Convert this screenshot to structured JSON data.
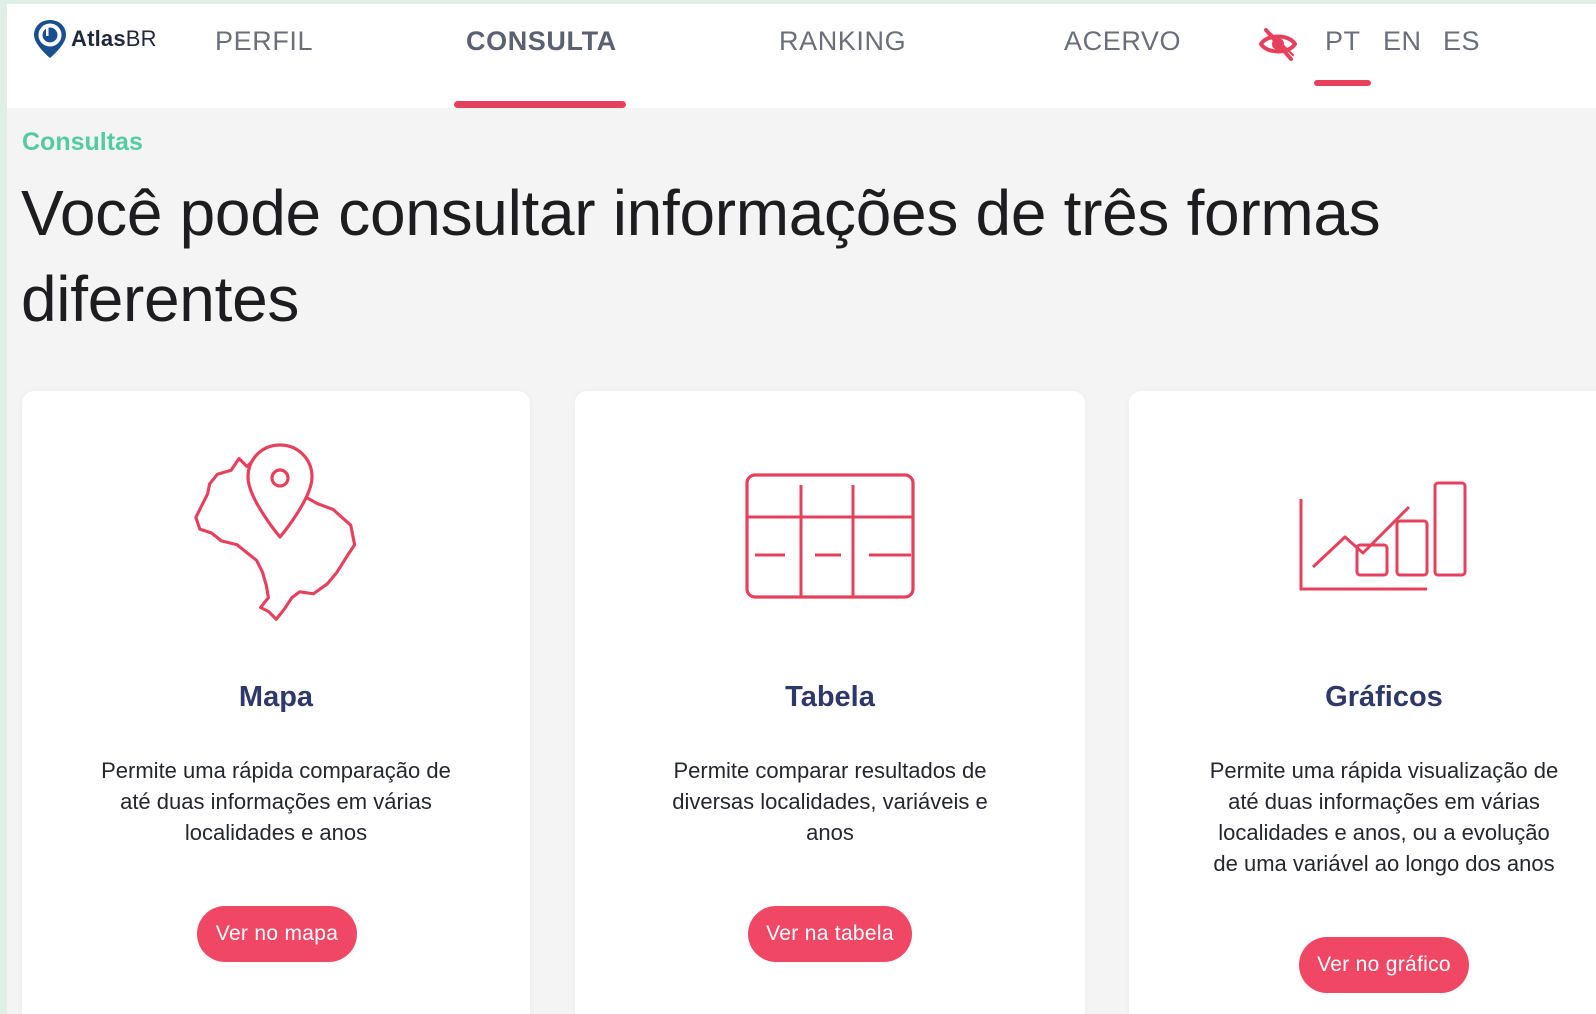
{
  "brand": {
    "name_bold": "Atlas",
    "name_light": "BR"
  },
  "nav": {
    "items": [
      {
        "label": "PERFIL"
      },
      {
        "label": "CONSULTA"
      },
      {
        "label": "RANKING"
      },
      {
        "label": "ACERVO"
      }
    ],
    "active": "CONSULTA",
    "languages": [
      "PT",
      "EN",
      "ES"
    ],
    "active_language": "PT",
    "accessibility_icon": "eye-off-icon"
  },
  "page": {
    "eyebrow": "Consultas",
    "headline": "Você pode consultar informações de três formas diferentes"
  },
  "cards": [
    {
      "icon": "brazil-map-pin-icon",
      "title": "Mapa",
      "desc_lines": [
        "Permite uma rápida comparação de",
        "até duas informações em várias",
        "localidades e anos"
      ],
      "button": "Ver no mapa"
    },
    {
      "icon": "table-icon",
      "title": "Tabela",
      "desc_lines": [
        "Permite comparar resultados de",
        "diversas localidades, variáveis e",
        "anos"
      ],
      "button": "Ver na tabela"
    },
    {
      "icon": "bar-line-chart-icon",
      "title": "Gráficos",
      "desc_lines": [
        "Permite uma rápida visualização de",
        "até duas informações em várias",
        "localidades e anos, ou a evolução",
        "de uma variável ao longo dos anos"
      ],
      "button": "Ver no gráfico"
    }
  ],
  "colors": {
    "accent": "#e7405d",
    "button": "#f04765",
    "eyebrow": "#54cba4",
    "card_title": "#2e3869",
    "logo": "#1a4f8f"
  }
}
